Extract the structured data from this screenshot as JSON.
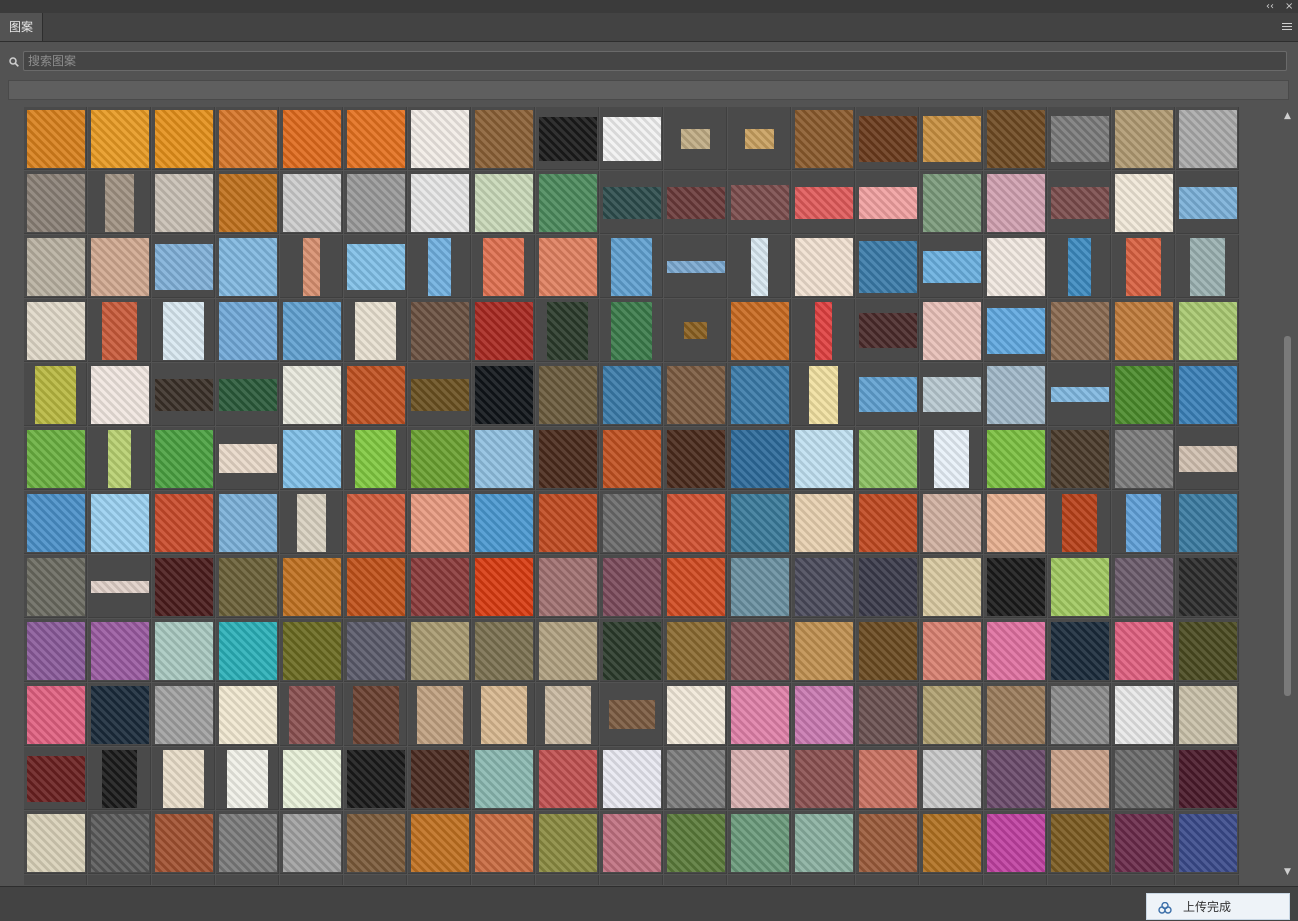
{
  "window": {
    "collapse_glyph": "‹‹",
    "close_glyph": "×"
  },
  "panel": {
    "tab_label": "图案",
    "menu_icon": "hamburger-menu-icon"
  },
  "search": {
    "icon": "search-icon",
    "placeholder": "搜索图案",
    "value": ""
  },
  "toast": {
    "icon": "cloud-sync-icon",
    "label": "上传完成"
  },
  "scrollbar": {
    "up_glyph": "▲",
    "down_glyph": "▼"
  },
  "patterns": {
    "tile_colors": [
      [
        "#d8801c",
        "#e89a22",
        "#e4901a",
        "#d67528",
        "#e06a1c",
        "#e4701e",
        "#f2ece6",
        "#8a6036",
        "#1a1a1a",
        "#f0f0f0",
        "#c0ac84",
        "#c8a060",
        "#8a5a2c",
        "#6a3a1c",
        "#c89040",
        "#6e4a22",
        "#7a7a7a",
        "#b09a72",
        "#aaaaaa"
      ],
      [
        "#8a8076",
        "#a09282",
        "#c8c0b4",
        "#c0701c",
        "#cccccc",
        "#999999",
        "#e6e6e6",
        "#c8d8b8",
        "#4c8a5c",
        "#2c4c4c",
        "#6a3a3a",
        "#7a4c4c",
        "#e05a5a",
        "#f0a0a0",
        "#7a9a7a",
        "#d0a0b0",
        "#7a4c4c",
        "#f0e8d8",
        "#7ab0d8"
      ],
      [
        "#b8b0a0",
        "#d0a890",
        "#80b0d8",
        "#80b8e0",
        "#d89070",
        "#80c0e8",
        "#70b0e0",
        "#e07050",
        "#e08060",
        "#60a0d0",
        "#7aa8d0",
        "#d8e8f0",
        "#f0e0d0",
        "#3a7aa8",
        "#6ab0e0",
        "#f0e8e0",
        "#3c8ac0",
        "#d86040",
        "#9ab0b0"
      ],
      [
        "#e0d8c8",
        "#c85a3a",
        "#d8e8f0",
        "#70a8d8",
        "#60a0d0",
        "#e8e0d0",
        "#6a5040",
        "#a82820",
        "#2a3a2a",
        "#3a7a4a",
        "#8a6020",
        "#c86a20",
        "#e04040",
        "#4a2a2a",
        "#e8c0b8",
        "#60a8e0",
        "#8a6a50",
        "#c07a3a",
        "#a8c870"
      ],
      [
        "#b8b840",
        "#f0e6e0",
        "#3a3028",
        "#2a5a3a",
        "#e8e8dc",
        "#c05020",
        "#6a5020",
        "#101418",
        "#6a5a3c",
        "#3a7aa8",
        "#7a5a40",
        "#3a7aa8",
        "#f0e0a0",
        "#60a0d0",
        "#b8c8d0",
        "#a0b8c8",
        "#80b8e0",
        "#4a8a2a",
        "#3a80b8"
      ],
      [
        "#6ab040",
        "#b8d070",
        "#4aa040",
        "#e8d8c8",
        "#80c0e8",
        "#80c840",
        "#6aa030",
        "#90c0e0",
        "#4a2a1c",
        "#c05020",
        "#4a2a1c",
        "#2c6a9a",
        "#c0e0f0",
        "#8ac060",
        "#e8f0f8",
        "#7ac040",
        "#4a3a2a",
        "#7a7a7a",
        "#d0c0b0"
      ],
      [
        "#4a90c8",
        "#9ad0f0",
        "#c84a2a",
        "#7ab0d8",
        "#d8d0c0",
        "#d05a3a",
        "#e89a80",
        "#4a98d0",
        "#c04a20",
        "#6a6a6a",
        "#d05030",
        "#3a7a9a",
        "#e8d0b0",
        "#c04820",
        "#d0b0a0",
        "#e8b090",
        "#b84018",
        "#60a0d8",
        "#3a7aa0"
      ],
      [
        "#6a6a60",
        "#e0d0c8",
        "#4a1c1c",
        "#6a6038",
        "#c07020",
        "#c05018",
        "#8a3a3a",
        "#d83a10",
        "#a07070",
        "#7a4a5a",
        "#d04a20",
        "#6a90a0",
        "#4a4a5a",
        "#3a3a4a",
        "#d8c8a0",
        "#1a1a1a",
        "#a0c860",
        "#6a5a6a",
        "#2a2a2a"
      ],
      [
        "#8a5a9a",
        "#9a5aa0",
        "#a8c8c0",
        "#2ab0b8",
        "#6a6a20",
        "#5a5a6a",
        "#a89a70",
        "#7a7050",
        "#b0a080",
        "#2a3a2a",
        "#8a6a30",
        "#7a5050",
        "#c09050",
        "#6a4a20",
        "#d88070",
        "#e070a0",
        "#1a2a3a",
        "#e06080",
        "#4a4a20"
      ],
      [
        "#e06080",
        "#1a2a3a",
        "#a0a0a0",
        "#f0e8d0",
        "#8a5050",
        "#6a4030",
        "#c0a080",
        "#d8b890",
        "#c8b8a0",
        "#7a5a40",
        "#f0e8d8",
        "#e080a8",
        "#c878b0",
        "#6a5050",
        "#b0a070",
        "#9a7a5a",
        "#8a8a8a",
        "#e8e8e8",
        "#c8c0a8"
      ],
      [
        "#6a2020",
        "#1a1a1a",
        "#e8dcc8",
        "#f0f0e8",
        "#e8f0d8",
        "#1a1a1a",
        "#4a2a20",
        "#8ab8b0",
        "#c05050",
        "#e8e8f0",
        "#7a7a7a",
        "#d8b0b0",
        "#8a5050",
        "#c87060",
        "#c8c8c8",
        "#6a4a6a",
        "#c8a088",
        "#6a6a6a",
        "#4a1a2a"
      ],
      [
        "#d8d0b8",
        "#5a5a5a",
        "#a05030",
        "#7a7a7a",
        "#a0a0a0",
        "#7a5a3a",
        "#c07020",
        "#c86a40",
        "#8a8a40",
        "#c07080",
        "#5a7a3a",
        "#6a9a7a",
        "#8ab0a0",
        "#9a5a3a",
        "#b07020",
        "#c040a0",
        "#7a5a20",
        "#6a2a4a",
        "#3a4a8a"
      ],
      [
        "#6a90c0",
        "#c07080",
        "#c07040",
        "#e07080",
        "#d090a0",
        "#8a6a40",
        "#c080a0",
        "#a06080",
        "#6ab070",
        "#e04080",
        "#c060a0",
        "#8a40a0",
        "#4a80c0",
        "#e08080",
        "#b0a070",
        "#40a0c0",
        "#e0c040",
        "#d0d0a0",
        "#8a6aa0"
      ]
    ],
    "tile_widths": [
      [
        1,
        1,
        1,
        1,
        1,
        1,
        1,
        1,
        1,
        1,
        0.5,
        0.5,
        1,
        1,
        1,
        1,
        1,
        1,
        1
      ],
      [
        1,
        0.5,
        1,
        1,
        1,
        1,
        1,
        1,
        1,
        1,
        1,
        1,
        1,
        1,
        1,
        1,
        1,
        1,
        1
      ],
      [
        1,
        1,
        1,
        1,
        0.3,
        1,
        0.4,
        0.7,
        1,
        0.7,
        1,
        0.3,
        1,
        1,
        1,
        1,
        0.4,
        0.6,
        0.6
      ],
      [
        1,
        0.6,
        0.7,
        1,
        1,
        0.7,
        1,
        1,
        0.7,
        0.7,
        0.4,
        1,
        0.3,
        1,
        1,
        1,
        1,
        1,
        1
      ],
      [
        0.7,
        1,
        1,
        1,
        1,
        1,
        1,
        1,
        1,
        1,
        1,
        1,
        0.5,
        1,
        1,
        1,
        1,
        1,
        1
      ],
      [
        1,
        0.4,
        1,
        1,
        1,
        0.7,
        1,
        1,
        1,
        1,
        1,
        1,
        1,
        1,
        0.6,
        1,
        1,
        1,
        1
      ],
      [
        1,
        1,
        1,
        1,
        0.5,
        1,
        1,
        1,
        1,
        1,
        1,
        1,
        1,
        1,
        1,
        1,
        0.6,
        0.6,
        1
      ],
      [
        1,
        1,
        1,
        1,
        1,
        1,
        1,
        1,
        1,
        1,
        1,
        1,
        1,
        1,
        1,
        1,
        1,
        1,
        1
      ],
      [
        1,
        1,
        1,
        1,
        1,
        1,
        1,
        1,
        1,
        1,
        1,
        1,
        1,
        1,
        1,
        1,
        1,
        1,
        1
      ],
      [
        1,
        1,
        1,
        1,
        0.8,
        0.8,
        0.8,
        0.8,
        0.8,
        0.8,
        1,
        1,
        1,
        1,
        1,
        1,
        1,
        1,
        1
      ],
      [
        1,
        0.6,
        0.7,
        0.7,
        1,
        1,
        1,
        1,
        1,
        1,
        1,
        1,
        1,
        1,
        1,
        1,
        1,
        1,
        1
      ],
      [
        1,
        1,
        1,
        1,
        1,
        1,
        1,
        1,
        1,
        1,
        1,
        1,
        1,
        1,
        1,
        1,
        1,
        1,
        1
      ],
      [
        1,
        1,
        1,
        1,
        1,
        1,
        1,
        1,
        1,
        1,
        1,
        1,
        1,
        1,
        1,
        1,
        1,
        1,
        1
      ]
    ],
    "tile_heights": [
      [
        1,
        1,
        1,
        1,
        1,
        1,
        1,
        1,
        0.75,
        0.75,
        0.35,
        0.35,
        1,
        0.8,
        0.8,
        1,
        0.8,
        1,
        1
      ],
      [
        1,
        1,
        1,
        1,
        1,
        1,
        1,
        1,
        1,
        0.55,
        0.55,
        0.6,
        0.55,
        0.55,
        1,
        1,
        0.55,
        1,
        0.55
      ],
      [
        1,
        1,
        0.8,
        1,
        1,
        0.8,
        1,
        1,
        1,
        1,
        0.2,
        1,
        1,
        0.9,
        0.55,
        1,
        1,
        1,
        1
      ],
      [
        1,
        1,
        1,
        1,
        1,
        1,
        1,
        1,
        1,
        1,
        0.3,
        1,
        1,
        0.6,
        1,
        0.8,
        1,
        1,
        1
      ],
      [
        1,
        1,
        0.55,
        0.55,
        1,
        1,
        0.55,
        1,
        1,
        1,
        1,
        1,
        1,
        0.6,
        0.6,
        1,
        0.25,
        1,
        1
      ],
      [
        1,
        1,
        1,
        0.5,
        1,
        1,
        1,
        1,
        1,
        1,
        1,
        1,
        1,
        1,
        1,
        1,
        1,
        1,
        0.45
      ],
      [
        1,
        1,
        1,
        1,
        1,
        1,
        1,
        1,
        1,
        1,
        1,
        1,
        1,
        1,
        1,
        1,
        1,
        1,
        1
      ],
      [
        1,
        0.2,
        1,
        1,
        1,
        1,
        1,
        1,
        1,
        1,
        1,
        1,
        1,
        1,
        1,
        1,
        1,
        1,
        1
      ],
      [
        1,
        1,
        1,
        1,
        1,
        1,
        1,
        1,
        1,
        1,
        1,
        1,
        1,
        1,
        1,
        1,
        1,
        1,
        1
      ],
      [
        1,
        1,
        1,
        1,
        1,
        1,
        1,
        1,
        1,
        0.5,
        1,
        1,
        1,
        1,
        1,
        1,
        1,
        1,
        1
      ],
      [
        0.8,
        1,
        1,
        1,
        1,
        1,
        1,
        1,
        1,
        1,
        1,
        1,
        1,
        1,
        1,
        1,
        1,
        1,
        1
      ],
      [
        1,
        1,
        1,
        1,
        1,
        1,
        1,
        1,
        1,
        1,
        1,
        1,
        1,
        1,
        1,
        1,
        1,
        1,
        1
      ],
      [
        0.2,
        0.2,
        0.2,
        0.2,
        0.2,
        0.2,
        0.2,
        0.2,
        0.2,
        0.2,
        0.2,
        0.2,
        0.2,
        0.2,
        0.2,
        0.2,
        0.2,
        0.2,
        0.2
      ]
    ]
  }
}
